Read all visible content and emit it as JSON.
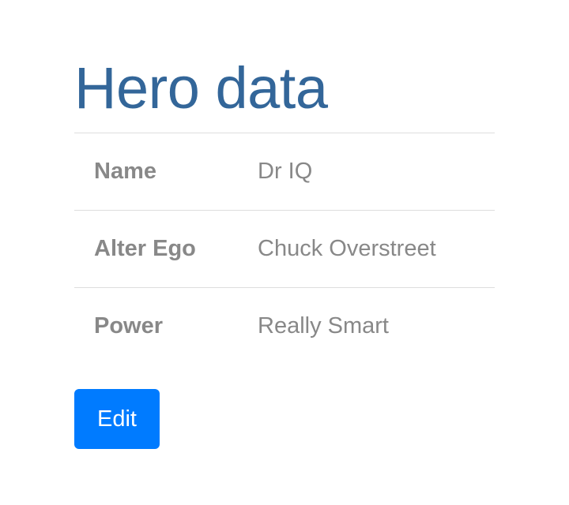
{
  "page": {
    "title": "Hero data"
  },
  "hero": {
    "rows": [
      {
        "label": "Name",
        "value": "Dr IQ"
      },
      {
        "label": "Alter Ego",
        "value": "Chuck Overstreet"
      },
      {
        "label": "Power",
        "value": "Really Smart"
      }
    ]
  },
  "actions": {
    "edit_label": "Edit"
  },
  "colors": {
    "title": "#336699",
    "text": "#888888",
    "button_bg": "#007bff",
    "button_text": "#ffffff",
    "divider": "#dddddd"
  }
}
